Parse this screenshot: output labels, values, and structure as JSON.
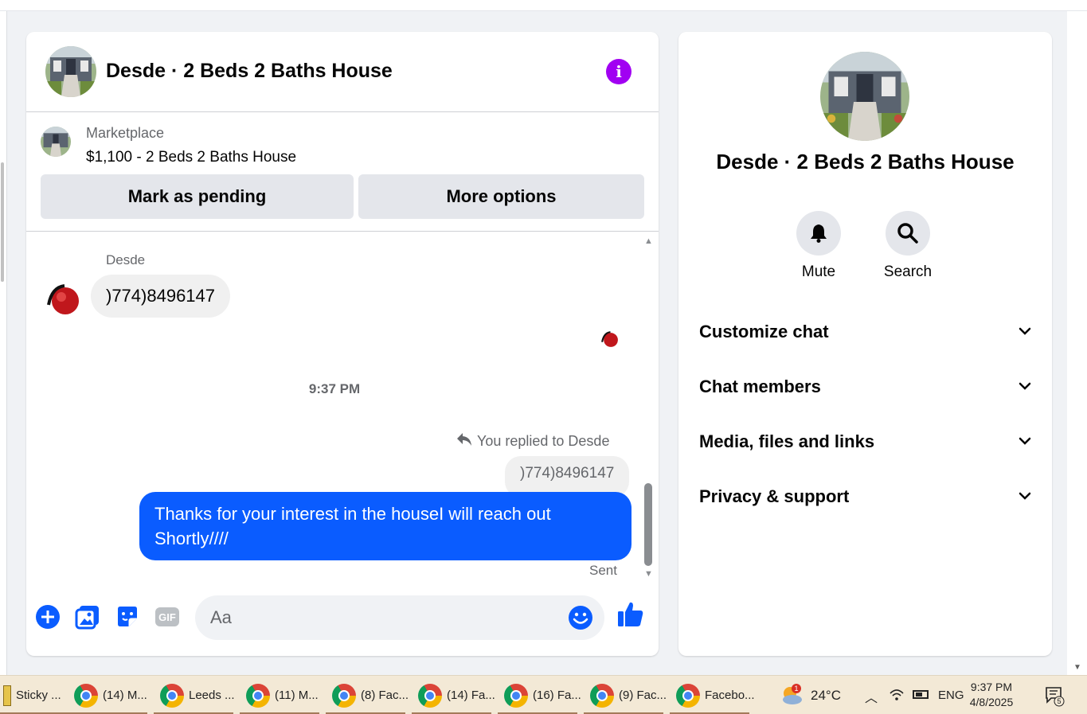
{
  "conversation": {
    "title": "Desde · 2 Beds 2 Baths House",
    "info_icon": "info-icon"
  },
  "marketplace": {
    "label": "Marketplace",
    "listing": "$1,100 - 2 Beds 2 Baths House",
    "mark_pending_label": "Mark as pending",
    "more_options_label": "More options"
  },
  "messages": {
    "sender_name": "Desde",
    "incoming_text": ")774)8496147",
    "timestamp": "9:37 PM",
    "reply_note": "You replied to Desde",
    "reply_quote": ")774)8496147",
    "outgoing_text": "Thanks for your interest in the houseI will reach out Shortly////",
    "status": "Sent"
  },
  "composer": {
    "placeholder": "Aa",
    "icons": [
      "plus-icon",
      "photo-icon",
      "sticker-icon",
      "gif-icon",
      "emoji-icon",
      "thumbs-up-icon"
    ],
    "gif_label": "GIF"
  },
  "info_panel": {
    "title": "Desde · 2 Beds 2 Baths House",
    "actions": [
      {
        "label": "Mute",
        "icon": "bell-icon"
      },
      {
        "label": "Search",
        "icon": "search-icon"
      }
    ],
    "sections": [
      {
        "label": "Customize chat"
      },
      {
        "label": "Chat members"
      },
      {
        "label": "Media, files and links"
      },
      {
        "label": "Privacy & support"
      }
    ]
  },
  "taskbar": {
    "items": [
      {
        "label": "Sticky ...",
        "icon": "sticky-notes-icon"
      },
      {
        "label": "(14) M...",
        "icon": "chrome-icon"
      },
      {
        "label": "Leeds ...",
        "icon": "chrome-icon"
      },
      {
        "label": "(11) M...",
        "icon": "chrome-icon"
      },
      {
        "label": "(8) Fac...",
        "icon": "chrome-icon"
      },
      {
        "label": "(14) Fa...",
        "icon": "chrome-icon"
      },
      {
        "label": "(16) Fa...",
        "icon": "chrome-icon"
      },
      {
        "label": "(9) Fac...",
        "icon": "chrome-icon"
      },
      {
        "label": "Facebo...",
        "icon": "chrome-icon"
      }
    ],
    "weather_badge": "1",
    "temperature": "24°C",
    "language": "ENG",
    "time": "9:37 PM",
    "date": "4/8/2025",
    "notification_count": "5"
  },
  "colors": {
    "accent": "#0a5cff",
    "info_purple": "#a100f2",
    "panel_bg": "#f0f2f5"
  }
}
